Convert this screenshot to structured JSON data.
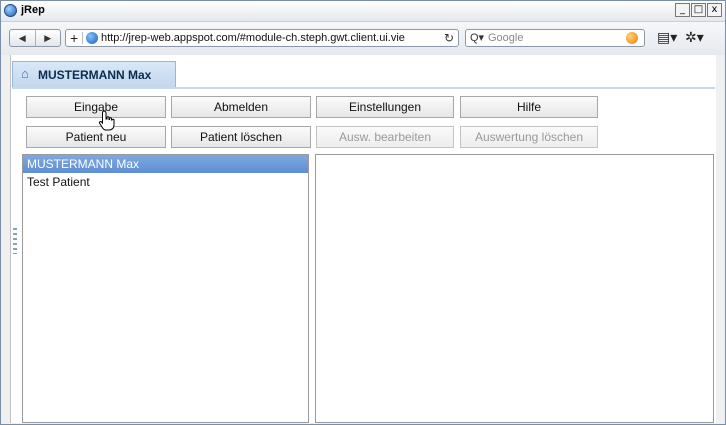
{
  "window": {
    "title": "jRep",
    "controls": {
      "minimize": "_",
      "maximize": "□",
      "close": "x"
    }
  },
  "browser": {
    "back_icon": "◀",
    "forward_icon": "▶",
    "add_icon": "+",
    "url": "http://jrep-web.appspot.com/#module-ch.steph.gwt.client.ui.vie",
    "reload_icon": "↻",
    "search_dropdown": "Q▾",
    "search_placeholder": "Google",
    "page_menu_icon": "▤▾",
    "tools_menu_icon": "✲▾"
  },
  "patient_tab": {
    "label": "MUSTERMANN Max"
  },
  "toolbar": {
    "row1": [
      "Eingabe",
      "Abmelden",
      "Einstellungen",
      "Hilfe"
    ],
    "row2": [
      "Patient neu",
      "Patient löschen",
      "Ausw. bearbeiten",
      "Auswertung löschen"
    ]
  },
  "patient_list": [
    {
      "name": "MUSTERMANN Max",
      "selected": true
    },
    {
      "name": "Test Patient",
      "selected": false
    }
  ],
  "colors": {
    "tab_bg": "#c2d7ee",
    "selection": "#6b97d8"
  }
}
